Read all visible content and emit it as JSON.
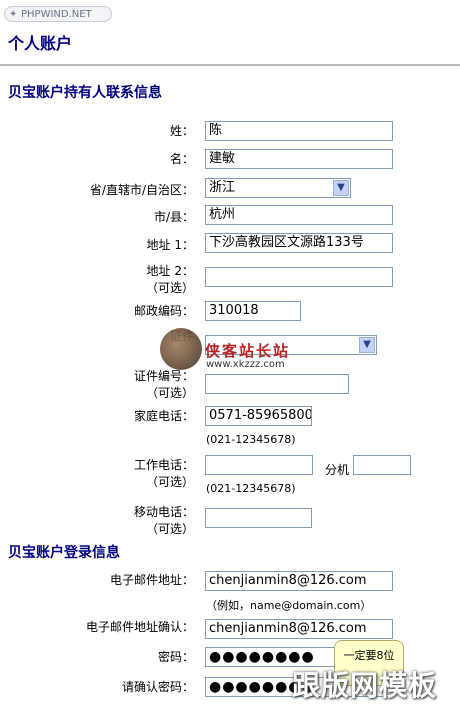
{
  "brand": {
    "logo_text": "PHPWIND.NET"
  },
  "page": {
    "title": "个人账户"
  },
  "contact_section": {
    "title": "贝宝账户持有人联系信息",
    "last_name_label": "姓：",
    "last_name_value": "陈",
    "first_name_label": "名：",
    "first_name_value": "建敏",
    "province_label": "省/直辖市/自治区：",
    "province_value": "浙江",
    "city_label": "市/县：",
    "city_value": "杭州",
    "address1_label": "地址 1：",
    "address1_value": "下沙高教园区文源路133号",
    "address2_label": "地址 2：",
    "optional": "（可选）",
    "zip_label": "邮政编码：",
    "zip_value": "310018",
    "id_type_label": "证件",
    "id_number_label": "证件编号：",
    "home_phone_label": "家庭电话：",
    "home_phone_value": "0571-85965800",
    "phone_format_hint": "(021-12345678)",
    "work_phone_label": "工作电话：",
    "extension_label": "分机",
    "mobile_label": "移动电话："
  },
  "login_section": {
    "title": "贝宝账户登录信息",
    "email_label": "电子邮件地址：",
    "email_value": "chenjianmin8@126.com",
    "email_hint": "（例如，name@domain.com）",
    "email_confirm_label": "电子邮件地址确认：",
    "email_confirm_value": "chenjianmin8@126.com",
    "password_label": "密码：",
    "password_value": "●●●●●●●●",
    "password_confirm_label": "请确认密码：",
    "password_confirm_value": "●●●●●●●●",
    "password_tip": "一定要8位"
  },
  "watermarks": {
    "site_name": "侠客站长站",
    "site_url": "www.xkzzz.com",
    "corner_text": "跟版网模板"
  }
}
